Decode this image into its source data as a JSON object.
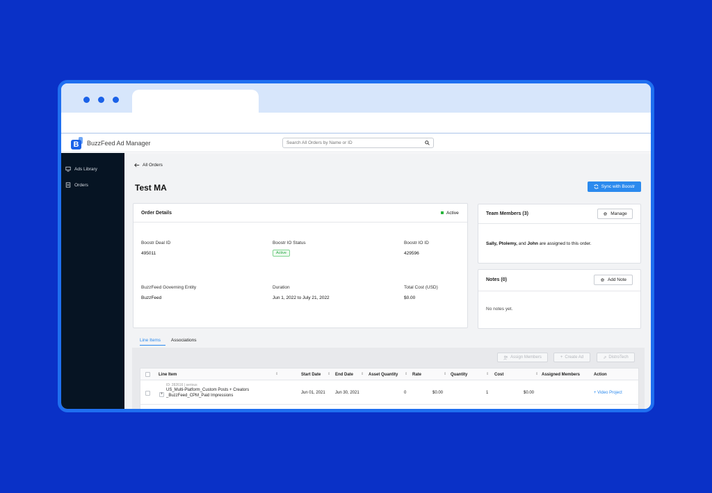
{
  "app": {
    "title": "BuzzFeed Ad Manager",
    "logo_letter": "B"
  },
  "search": {
    "placeholder": "Search All Orders by Name or ID"
  },
  "sidebar": {
    "items": [
      {
        "label": "Ads Library",
        "icon": "monitor-icon"
      },
      {
        "label": "Orders",
        "icon": "list-icon"
      }
    ]
  },
  "nav": {
    "back_label": "All Orders"
  },
  "page": {
    "title": "Test MA",
    "sync_label": "Sync with Boostr"
  },
  "order_details": {
    "title": "Order Details",
    "status": "Active",
    "fields": {
      "deal_id_label": "Boostr Deal ID",
      "deal_id": "495011",
      "io_status_label": "Boostr IO Status",
      "io_status": "Active",
      "io_id_label": "Boostr IO ID",
      "io_id": "429596",
      "entity_label": "BuzzFeed Governing Entity",
      "entity": "BuzzFeed",
      "duration_label": "Duration",
      "duration": "Jun 1, 2022 to July 21, 2022",
      "total_cost_label": "Total Cost (USD)",
      "total_cost": "$0.00"
    }
  },
  "team": {
    "title": "Team Members (3)",
    "manage_label": "Manage",
    "member1": "Sally,",
    "member2": "Ptolemy,",
    "and_text": "and",
    "member3": "John",
    "suffix": "are assigned to this order."
  },
  "notes": {
    "title": "Notes (0)",
    "add_label": "Add Note",
    "empty": "No notes yet."
  },
  "tabs": [
    {
      "label": "Line Items",
      "active": true
    },
    {
      "label": "Associations",
      "active": false
    }
  ],
  "toolbar": {
    "assign_label": "Assign Members",
    "create_label": "Create Ad",
    "distro_label": "DistroTech"
  },
  "table": {
    "columns": [
      "Line Item",
      "Start Date",
      "End Date",
      "Asset Quantity",
      "Rate",
      "Quantity",
      "Cost",
      "Assigned Members",
      "Action"
    ],
    "rows": [
      {
        "meta": "ID: 282616 | serious",
        "name_line1": "US_Multi-Platform_Custom Posts + Creators",
        "name_line2": "_BuzzFeed_CPM_Paid Impressions",
        "start": "Jun 01, 2021",
        "end": "Jun 30, 2021",
        "asset_qty": "0",
        "rate": "$0.00",
        "quantity": "1",
        "cost": "$0.00",
        "members": "",
        "action": "Video Project"
      }
    ]
  },
  "colors": {
    "background": "#0a31c7",
    "frame": "#1f6ff0",
    "accent": "#2b8aee",
    "sidebar": "#061423",
    "success": "#28b43c"
  }
}
